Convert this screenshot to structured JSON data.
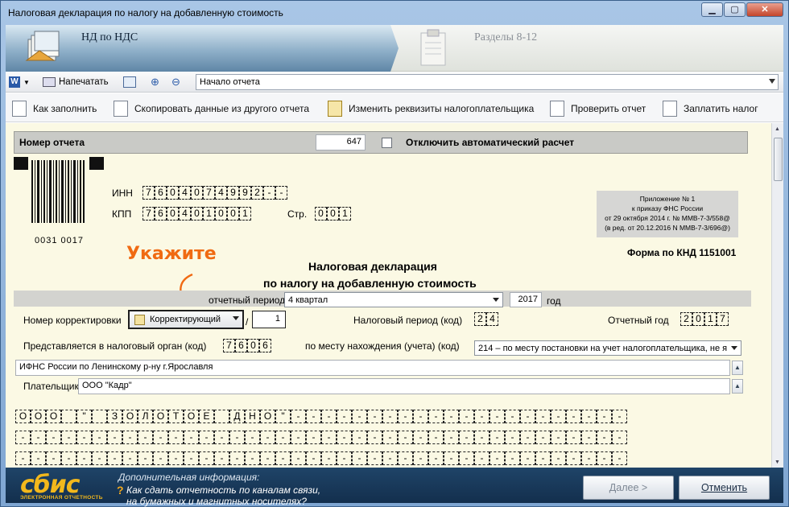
{
  "window": {
    "title": "Налоговая декларация по налогу на добавленную стоимость"
  },
  "wizard": {
    "step1": "НД по НДС",
    "step2": "Разделы 8-12"
  },
  "toolbar": {
    "print_label": "Напечатать",
    "section_value": "Начало отчета"
  },
  "actions": {
    "how_to_fill": "Как заполнить",
    "copy_from": "Скопировать данные из другого отчета",
    "change_details": "Изменить реквизиты налогоплательщика",
    "check": "Проверить отчет",
    "pay": "Заплатить налог"
  },
  "form": {
    "report_number_label": "Номер отчета",
    "report_number": "647",
    "autocalc_label": "Отключить автоматический расчет",
    "inn_label": "ИНН",
    "inn": [
      "7",
      "6",
      "0",
      "4",
      "0",
      "7",
      "4",
      "9",
      "9",
      "2",
      "-",
      "-"
    ],
    "kpp_label": "КПП",
    "kpp": [
      "7",
      "6",
      "0",
      "4",
      "0",
      "1",
      "0",
      "0",
      "1"
    ],
    "page_label": "Стр.",
    "page": [
      "0",
      "0",
      "1"
    ],
    "barcode_number": "0031 0017",
    "appendix_lines": [
      "Приложение № 1",
      "к приказу ФНС России",
      "от 29 октября 2014 г. № ММВ-7-3/558@",
      "(в ред. от 20.12.2016 N ММВ-7-3/696@)"
    ],
    "form_code": "Форма по КНД 1151001",
    "heading_line1": "Налоговая декларация",
    "heading_line2": "по налогу на добавленную стоимость",
    "hint": "Укажите",
    "period_label": "отчетный период",
    "period_value": "4 квартал",
    "year_value": "2017",
    "year_label": "год",
    "correction_label": "Номер корректировки",
    "correction_type": "Корректирующий",
    "correction_sep": "/",
    "correction_number": "1",
    "tax_period_label": "Налоговый период (код)",
    "tax_period": [
      "2",
      "4"
    ],
    "report_year_label": "Отчетный год",
    "report_year": [
      "2",
      "0",
      "1",
      "7"
    ],
    "authority_label": "Представляется в налоговый орган (код)",
    "authority": [
      "7",
      "6",
      "0",
      "6"
    ],
    "location_label": "по месту нахождения (учета) (код)",
    "location_value": "214 – по месту постановки на учет налогоплательщика, не я",
    "authority_name": "ИФНС России по Ленинскому р-ну г.Ярославля",
    "payer_label": "Плательщик:",
    "payer_value": "ООО \"Кадр\"",
    "name_row1": [
      "О",
      "О",
      "О",
      " ",
      "\"",
      " ",
      "З",
      "О",
      "Л",
      "О",
      "Т",
      "О",
      "Е",
      " ",
      "Д",
      "Н",
      "О",
      "\"",
      "-",
      "-",
      "-",
      "-",
      "-",
      "-",
      "-",
      "-",
      "-",
      "-",
      "-",
      "-",
      "-",
      "-",
      "-",
      "-",
      "-",
      "-",
      "-",
      "-",
      "-",
      "-"
    ]
  },
  "footer": {
    "logo": "сбис",
    "logo_sub": "ЭЛЕКТРОННАЯ ОТЧЕТНОСТЬ",
    "info_title": "Дополнительная информация:",
    "info_line1": "Как сдать отчетность по каналам связи,",
    "info_line2": "на бумажных и магнитных носителях?",
    "next": "Далее >",
    "cancel": "Отменить"
  }
}
